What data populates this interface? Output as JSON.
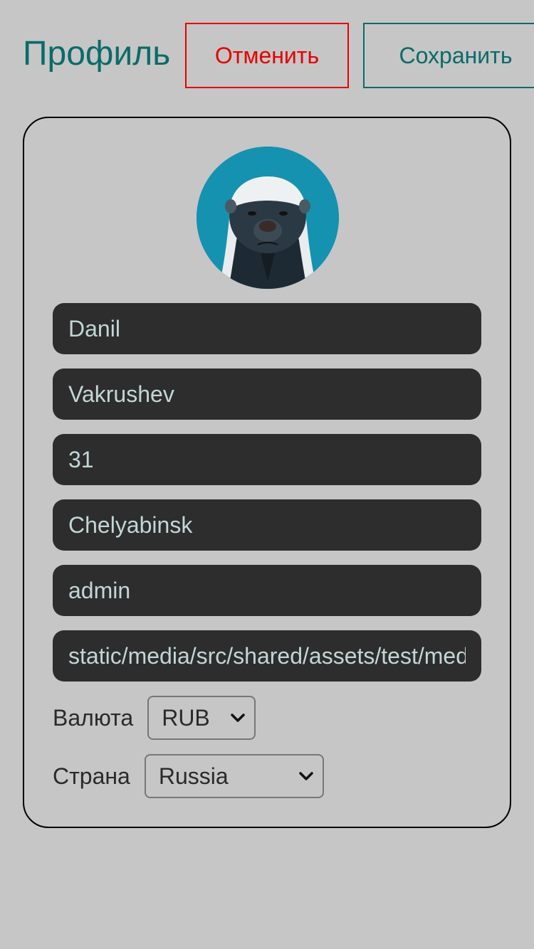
{
  "header": {
    "title": "Профиль",
    "cancel_label": "Отменить",
    "save_label": "Сохранить"
  },
  "profile": {
    "first_name": "Danil",
    "last_name": "Vakrushev",
    "age": "31",
    "city": "Chelyabinsk",
    "username": "admin",
    "avatar_url": "static/media/src/shared/assets/test/media"
  },
  "currency": {
    "label": "Валюта",
    "selected": "RUB"
  },
  "country": {
    "label": "Страна",
    "selected": "Russia"
  },
  "colors": {
    "background": "#c6c6c6",
    "accent": "#0b6b69",
    "danger": "#e60000",
    "field_bg": "#2d2d2d",
    "field_text": "#c2d6d5",
    "avatar_bg": "#1592b0"
  }
}
